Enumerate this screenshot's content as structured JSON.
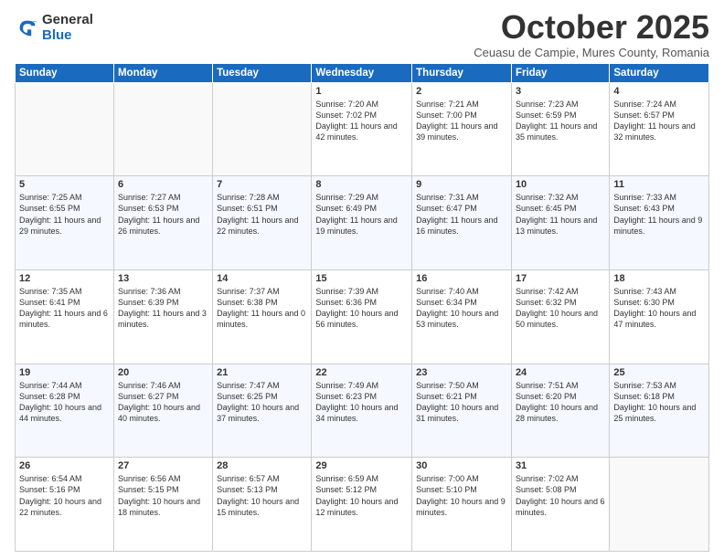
{
  "logo": {
    "general": "General",
    "blue": "Blue"
  },
  "title": "October 2025",
  "subtitle": "Ceuasu de Campie, Mures County, Romania",
  "days": [
    "Sunday",
    "Monday",
    "Tuesday",
    "Wednesday",
    "Thursday",
    "Friday",
    "Saturday"
  ],
  "weeks": [
    [
      {
        "day": "",
        "content": ""
      },
      {
        "day": "",
        "content": ""
      },
      {
        "day": "",
        "content": ""
      },
      {
        "day": "1",
        "content": "Sunrise: 7:20 AM\nSunset: 7:02 PM\nDaylight: 11 hours and 42 minutes."
      },
      {
        "day": "2",
        "content": "Sunrise: 7:21 AM\nSunset: 7:00 PM\nDaylight: 11 hours and 39 minutes."
      },
      {
        "day": "3",
        "content": "Sunrise: 7:23 AM\nSunset: 6:59 PM\nDaylight: 11 hours and 35 minutes."
      },
      {
        "day": "4",
        "content": "Sunrise: 7:24 AM\nSunset: 6:57 PM\nDaylight: 11 hours and 32 minutes."
      }
    ],
    [
      {
        "day": "5",
        "content": "Sunrise: 7:25 AM\nSunset: 6:55 PM\nDaylight: 11 hours and 29 minutes."
      },
      {
        "day": "6",
        "content": "Sunrise: 7:27 AM\nSunset: 6:53 PM\nDaylight: 11 hours and 26 minutes."
      },
      {
        "day": "7",
        "content": "Sunrise: 7:28 AM\nSunset: 6:51 PM\nDaylight: 11 hours and 22 minutes."
      },
      {
        "day": "8",
        "content": "Sunrise: 7:29 AM\nSunset: 6:49 PM\nDaylight: 11 hours and 19 minutes."
      },
      {
        "day": "9",
        "content": "Sunrise: 7:31 AM\nSunset: 6:47 PM\nDaylight: 11 hours and 16 minutes."
      },
      {
        "day": "10",
        "content": "Sunrise: 7:32 AM\nSunset: 6:45 PM\nDaylight: 11 hours and 13 minutes."
      },
      {
        "day": "11",
        "content": "Sunrise: 7:33 AM\nSunset: 6:43 PM\nDaylight: 11 hours and 9 minutes."
      }
    ],
    [
      {
        "day": "12",
        "content": "Sunrise: 7:35 AM\nSunset: 6:41 PM\nDaylight: 11 hours and 6 minutes."
      },
      {
        "day": "13",
        "content": "Sunrise: 7:36 AM\nSunset: 6:39 PM\nDaylight: 11 hours and 3 minutes."
      },
      {
        "day": "14",
        "content": "Sunrise: 7:37 AM\nSunset: 6:38 PM\nDaylight: 11 hours and 0 minutes."
      },
      {
        "day": "15",
        "content": "Sunrise: 7:39 AM\nSunset: 6:36 PM\nDaylight: 10 hours and 56 minutes."
      },
      {
        "day": "16",
        "content": "Sunrise: 7:40 AM\nSunset: 6:34 PM\nDaylight: 10 hours and 53 minutes."
      },
      {
        "day": "17",
        "content": "Sunrise: 7:42 AM\nSunset: 6:32 PM\nDaylight: 10 hours and 50 minutes."
      },
      {
        "day": "18",
        "content": "Sunrise: 7:43 AM\nSunset: 6:30 PM\nDaylight: 10 hours and 47 minutes."
      }
    ],
    [
      {
        "day": "19",
        "content": "Sunrise: 7:44 AM\nSunset: 6:28 PM\nDaylight: 10 hours and 44 minutes."
      },
      {
        "day": "20",
        "content": "Sunrise: 7:46 AM\nSunset: 6:27 PM\nDaylight: 10 hours and 40 minutes."
      },
      {
        "day": "21",
        "content": "Sunrise: 7:47 AM\nSunset: 6:25 PM\nDaylight: 10 hours and 37 minutes."
      },
      {
        "day": "22",
        "content": "Sunrise: 7:49 AM\nSunset: 6:23 PM\nDaylight: 10 hours and 34 minutes."
      },
      {
        "day": "23",
        "content": "Sunrise: 7:50 AM\nSunset: 6:21 PM\nDaylight: 10 hours and 31 minutes."
      },
      {
        "day": "24",
        "content": "Sunrise: 7:51 AM\nSunset: 6:20 PM\nDaylight: 10 hours and 28 minutes."
      },
      {
        "day": "25",
        "content": "Sunrise: 7:53 AM\nSunset: 6:18 PM\nDaylight: 10 hours and 25 minutes."
      }
    ],
    [
      {
        "day": "26",
        "content": "Sunrise: 6:54 AM\nSunset: 5:16 PM\nDaylight: 10 hours and 22 minutes."
      },
      {
        "day": "27",
        "content": "Sunrise: 6:56 AM\nSunset: 5:15 PM\nDaylight: 10 hours and 18 minutes."
      },
      {
        "day": "28",
        "content": "Sunrise: 6:57 AM\nSunset: 5:13 PM\nDaylight: 10 hours and 15 minutes."
      },
      {
        "day": "29",
        "content": "Sunrise: 6:59 AM\nSunset: 5:12 PM\nDaylight: 10 hours and 12 minutes."
      },
      {
        "day": "30",
        "content": "Sunrise: 7:00 AM\nSunset: 5:10 PM\nDaylight: 10 hours and 9 minutes."
      },
      {
        "day": "31",
        "content": "Sunrise: 7:02 AM\nSunset: 5:08 PM\nDaylight: 10 hours and 6 minutes."
      },
      {
        "day": "",
        "content": ""
      }
    ]
  ]
}
